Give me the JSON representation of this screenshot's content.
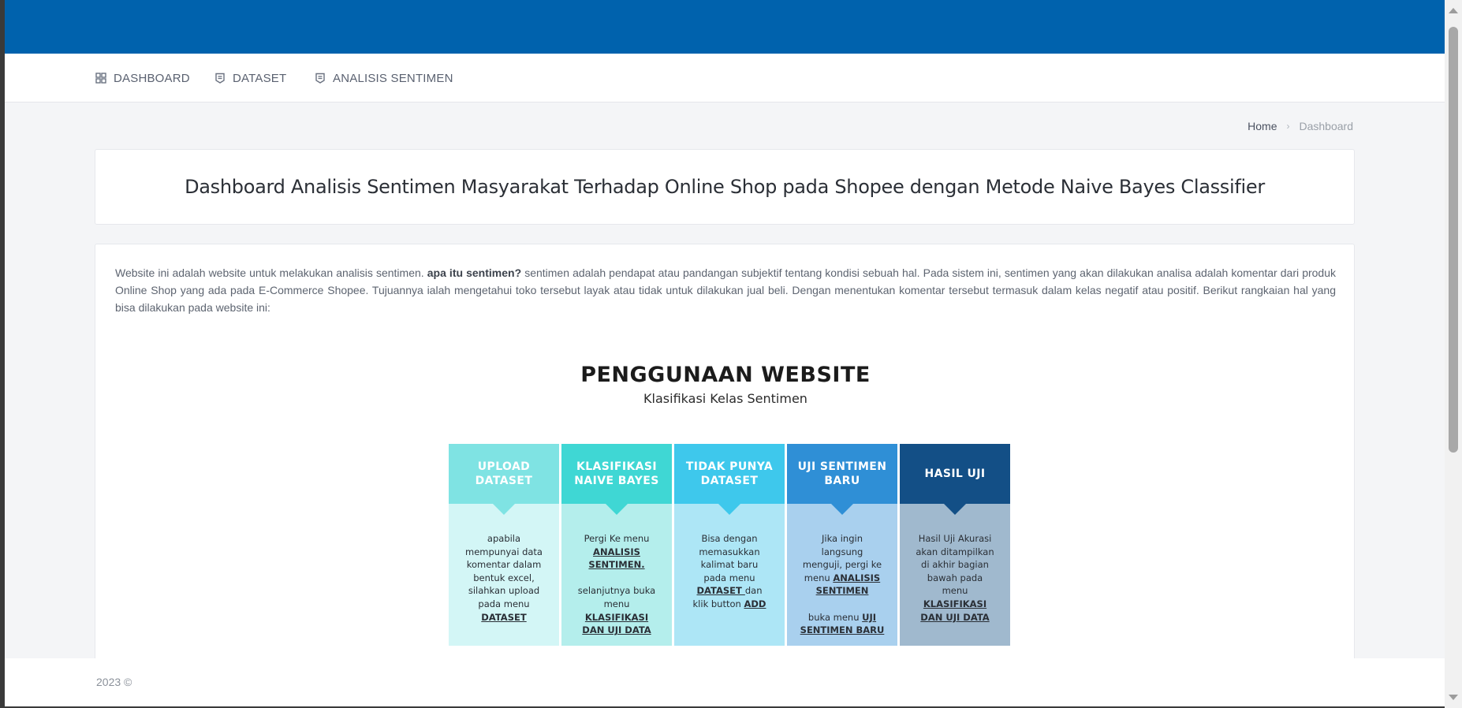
{
  "nav": {
    "items": [
      {
        "label": "DASHBOARD",
        "icon": "grid-icon"
      },
      {
        "label": "DATASET",
        "icon": "document-icon"
      },
      {
        "label": "ANALISIS SENTIMEN",
        "icon": "document-icon"
      }
    ]
  },
  "breadcrumb": {
    "home": "Home",
    "current": "Dashboard"
  },
  "page": {
    "title": "Dashboard Analisis Sentimen Masyarakat Terhadap Online Shop pada Shopee dengan Metode Naive Bayes Classifier"
  },
  "intro": {
    "part1": "Website ini adalah website untuk melakukan analisis sentimen. ",
    "bold": "apa itu sentimen?",
    "part2": " sentimen adalah pendapat atau pandangan subjektif tentang kondisi sebuah hal. Pada sistem ini, sentimen yang akan dilakukan analisa adalah komentar dari produk Online Shop yang ada pada E-Commerce Shopee. Tujuannya ialah mengetahui toko tersebut layak atau tidak untuk dilakukan jual beli. Dengan menentukan komentar tersebut termasuk dalam kelas negatif atau positif. Berikut rangkaian hal yang bisa dilakukan pada website ini:"
  },
  "infographic": {
    "title": "PENGGUNAAN WEBSITE",
    "subtitle": "Klasifikasi Kelas Sentimen",
    "columns": [
      {
        "head1": "UPLOAD",
        "head2": "DATASET",
        "head_color": "#7fe3e3",
        "body_color": "#d3f6f6",
        "t1": "apabila",
        "t2": "mempunyai data",
        "t3": "komentar dalam",
        "t4": "bentuk excel,",
        "t5": "silahkan upload",
        "t6": "pada menu",
        "link1": "DATASET"
      },
      {
        "head1": "KLASIFIKASI",
        "head2": "NAIVE BAYES",
        "head_color": "#3fd7d4",
        "body_color": "#b4eeec",
        "t1": "Pergi Ke menu",
        "link1": "ANALISIS",
        "link2": "SENTIMEN.",
        "t2": "selanjutnya buka",
        "t3": "menu",
        "link3": "KLASIFIKASI",
        "link4": "DAN UJI DATA"
      },
      {
        "head1": "TIDAK PUNYA",
        "head2": "DATASET",
        "head_color": "#3ec8ec",
        "body_color": "#ade6f6",
        "t1": "Bisa  dengan",
        "t2": "memasukkan",
        "t3": "kalimat baru",
        "t4": "pada menu",
        "link1": "DATASET ",
        "t5": "dan",
        "t6": "klik button ",
        "link2": "ADD"
      },
      {
        "head1": "UJI SENTIMEN",
        "head2": "BARU",
        "head_color": "#2f8fd6",
        "body_color": "#a9d0ee",
        "t1": "Jika ingin",
        "t2": "langsung",
        "t3": "menguji, pergi ke",
        "t4": "menu ",
        "link1": "ANALISIS",
        "link2": "SENTIMEN",
        "t5": "buka menu ",
        "link3": "UJI",
        "link4": "SENTIMEN BARU"
      },
      {
        "head1": "HASIL UJI",
        "head_color": "#134f86",
        "body_color": "#a0b9ce",
        "t1": "Hasil Uji Akurasi",
        "t2": "akan ditampilkan",
        "t3": "di akhir bagian",
        "t4": "bawah pada",
        "t5": "menu",
        "link1": "KLASIFIKASI",
        "link2": "DAN UJI DATA"
      }
    ]
  },
  "footer": {
    "text": "2023 ©"
  }
}
